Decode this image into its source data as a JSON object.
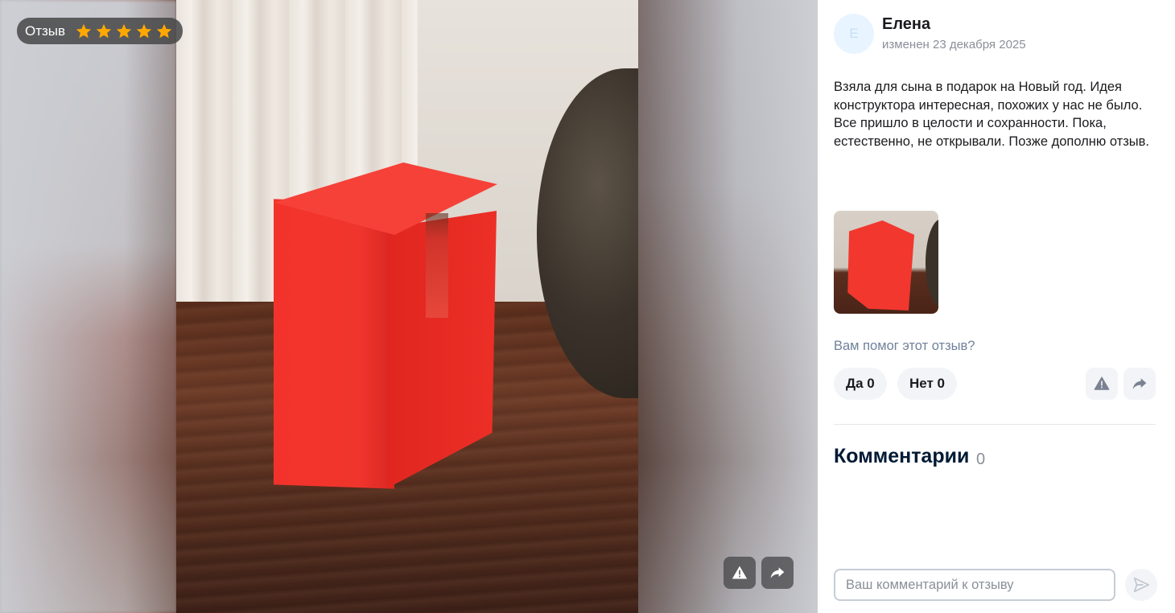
{
  "media": {
    "rating_chip": {
      "label": "Отзыв",
      "stars": 5,
      "max_stars": 5,
      "star_color": "#ffa800",
      "star_icon": "star-icon"
    },
    "actions": [
      {
        "name": "report",
        "icon": "warning-icon"
      },
      {
        "name": "share",
        "icon": "share-icon"
      }
    ],
    "photo_subject": "red-box-on-table"
  },
  "review": {
    "author_initial": "Е",
    "author": "Елена",
    "date": "изменен 23 декабря 2025",
    "text_lines": [
      "Взяла для сына в подарок на Новый год. Идея конструктора интересная, похожих у нас не было.",
      "Все пришло в целости и сохранности. Пока, естественно, не открывали. Позже дополню отзыв."
    ],
    "helpful_question": "Вам помог этот отзыв?",
    "vote_yes": "Да 0",
    "vote_no": "Нет 0",
    "report_icon": "warning-icon",
    "share_icon": "share-icon"
  },
  "comments": {
    "title": "Комментарии",
    "count": "0",
    "input_placeholder": "Ваш комментарий к отзыву",
    "send_icon": "send-icon"
  },
  "colors": {
    "accent_text": "#70819a",
    "title": "#001a34",
    "button_bg": "#f2f4f7",
    "avatar_bg": "#e8f4ff"
  }
}
